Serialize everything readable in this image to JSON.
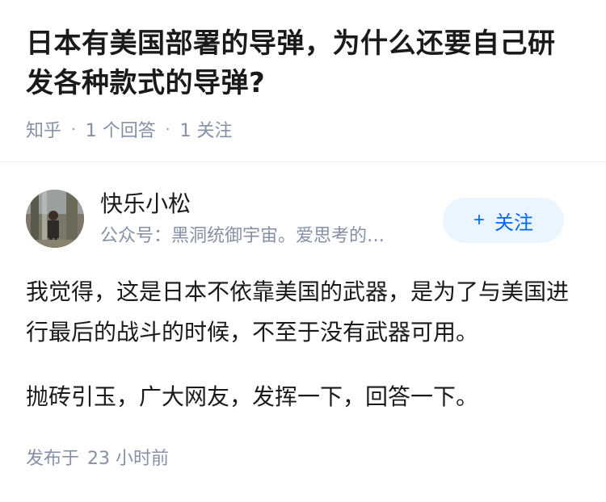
{
  "question": {
    "title": "日本有美国部署的导弹，为什么还要自己研发各种款式的导弹?",
    "source": "知乎",
    "answer_count": "1 个回答",
    "follow_count": "1 关注",
    "separator": "·"
  },
  "author": {
    "name": "快乐小松",
    "bio": "公众号：黑洞统御宇宙。爱思考的…",
    "follow_button": "关注",
    "follow_icon": "plus-icon"
  },
  "answer": {
    "paragraphs": [
      "我觉得，这是日本不依靠美国的武器，是为了与美国进行最后的战斗的时候，不至于没有武器可用。",
      "抛砖引玉，广大网友，发挥一下，回答一下。"
    ],
    "published_label": "发布于",
    "published_time": "23 小时前"
  },
  "colors": {
    "accent": "#0066ff",
    "accent_bg": "#ebf5ff",
    "meta_text": "#8590a6",
    "body_text": "#1a1a1a"
  }
}
